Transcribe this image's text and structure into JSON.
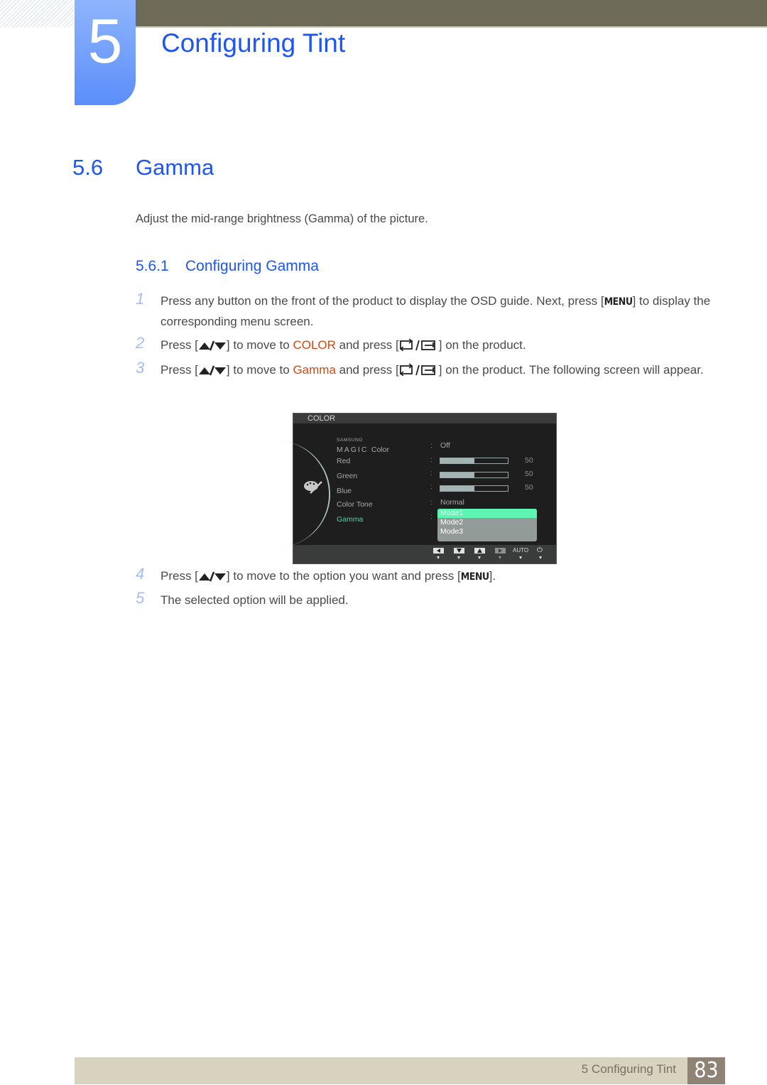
{
  "chapter": {
    "number": "5",
    "title": "Configuring Tint"
  },
  "section": {
    "number": "5.6",
    "title": "Gamma",
    "intro": "Adjust the mid-range brightness (Gamma) of the picture."
  },
  "subsection": {
    "number": "5.6.1",
    "title": "Configuring Gamma"
  },
  "steps": [
    {
      "num": "1",
      "a": "Press any button on the front of the product to display the OSD guide. Next, press [",
      "key": "MENU",
      "b": "] to display the corresponding menu screen."
    },
    {
      "num": "2",
      "a": "Press [",
      "a2": "] to move to ",
      "highlight": "COLOR",
      "b": " and press [",
      "c": "] on the product."
    },
    {
      "num": "3",
      "a": "Press [",
      "a2": "] to move to ",
      "highlight": "Gamma",
      "b": " and press [",
      "c": "] on the product. The following screen will appear."
    },
    {
      "num": "4",
      "a": "Press [",
      "a2": "] to move to the option you want and press [",
      "key": "MENU",
      "b": "]."
    },
    {
      "num": "5",
      "a": "The selected option will be applied."
    }
  ],
  "osd": {
    "header": "COLOR",
    "magic_brand": "SAMSUNG",
    "magic_word": "MAGIC",
    "items": [
      {
        "label": "Color",
        "value": "Off"
      },
      {
        "label": "Red",
        "value": "50",
        "level": 0.5
      },
      {
        "label": "Green",
        "value": "50",
        "level": 0.5
      },
      {
        "label": "Blue",
        "value": "50",
        "level": 0.5
      },
      {
        "label": "Color Tone",
        "value": "Normal"
      },
      {
        "label": "Gamma"
      }
    ],
    "gamma_options": [
      "Mode1",
      "Mode2",
      "Mode3"
    ],
    "gamma_selected": "Mode1",
    "footer_auto": "AUTO",
    "colon": ":"
  },
  "footer": {
    "chapter_label": "5 Configuring Tint",
    "page": "83"
  }
}
